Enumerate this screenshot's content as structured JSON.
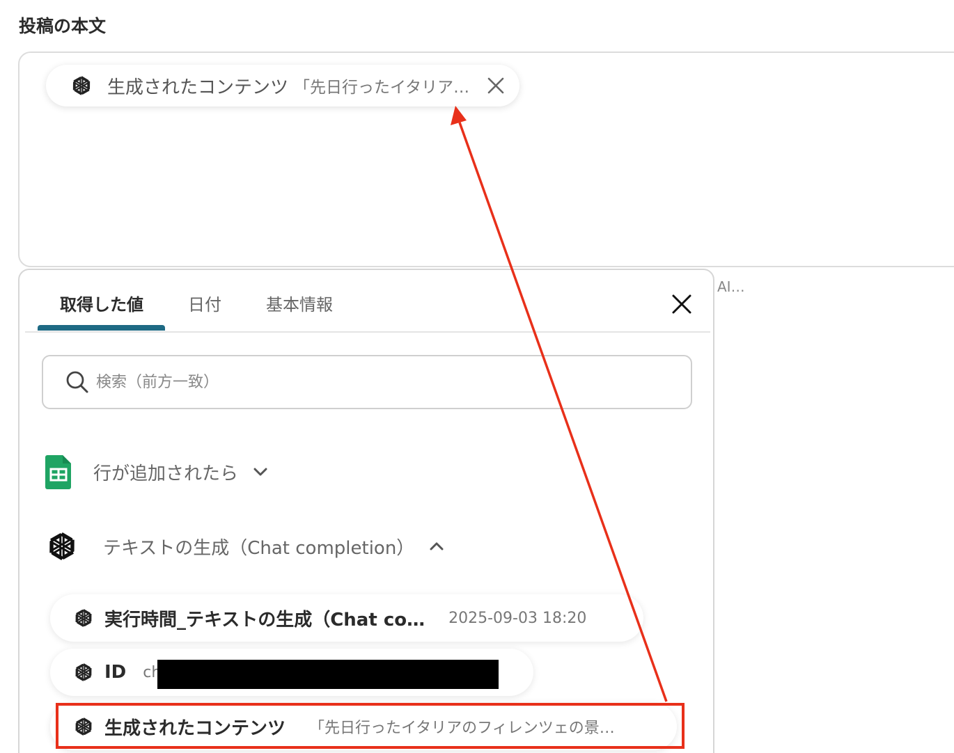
{
  "field": {
    "label": "投稿の本文"
  },
  "chip": {
    "icon": "openai-icon",
    "title": "生成されたコンテンツ",
    "value": "「先日行ったイタリア…"
  },
  "side_text": "AI…",
  "panel": {
    "tabs": [
      {
        "label": "取得した値",
        "active": true
      },
      {
        "label": "日付",
        "active": false
      },
      {
        "label": "基本情報",
        "active": false
      }
    ],
    "search_placeholder": "検索（前方一致）",
    "sections": [
      {
        "title": "行が追加されたら",
        "icon": "google-sheets-icon",
        "expanded": false
      },
      {
        "title": "テキストの生成（Chat completion）",
        "icon": "openai-icon",
        "expanded": true
      }
    ],
    "items": [
      {
        "title": "実行時間_テキストの生成（Chat co…",
        "value": "2025-09-03 18:20"
      },
      {
        "title": "ID",
        "value": "ch"
      },
      {
        "title": "生成されたコンテンツ",
        "value": "「先日行ったイタリアのフィレンツェの景…"
      }
    ]
  },
  "colors": {
    "tab_indicator": "#1e6a84",
    "annotation": "#e8301a",
    "sheets_green": "#1fa463"
  }
}
